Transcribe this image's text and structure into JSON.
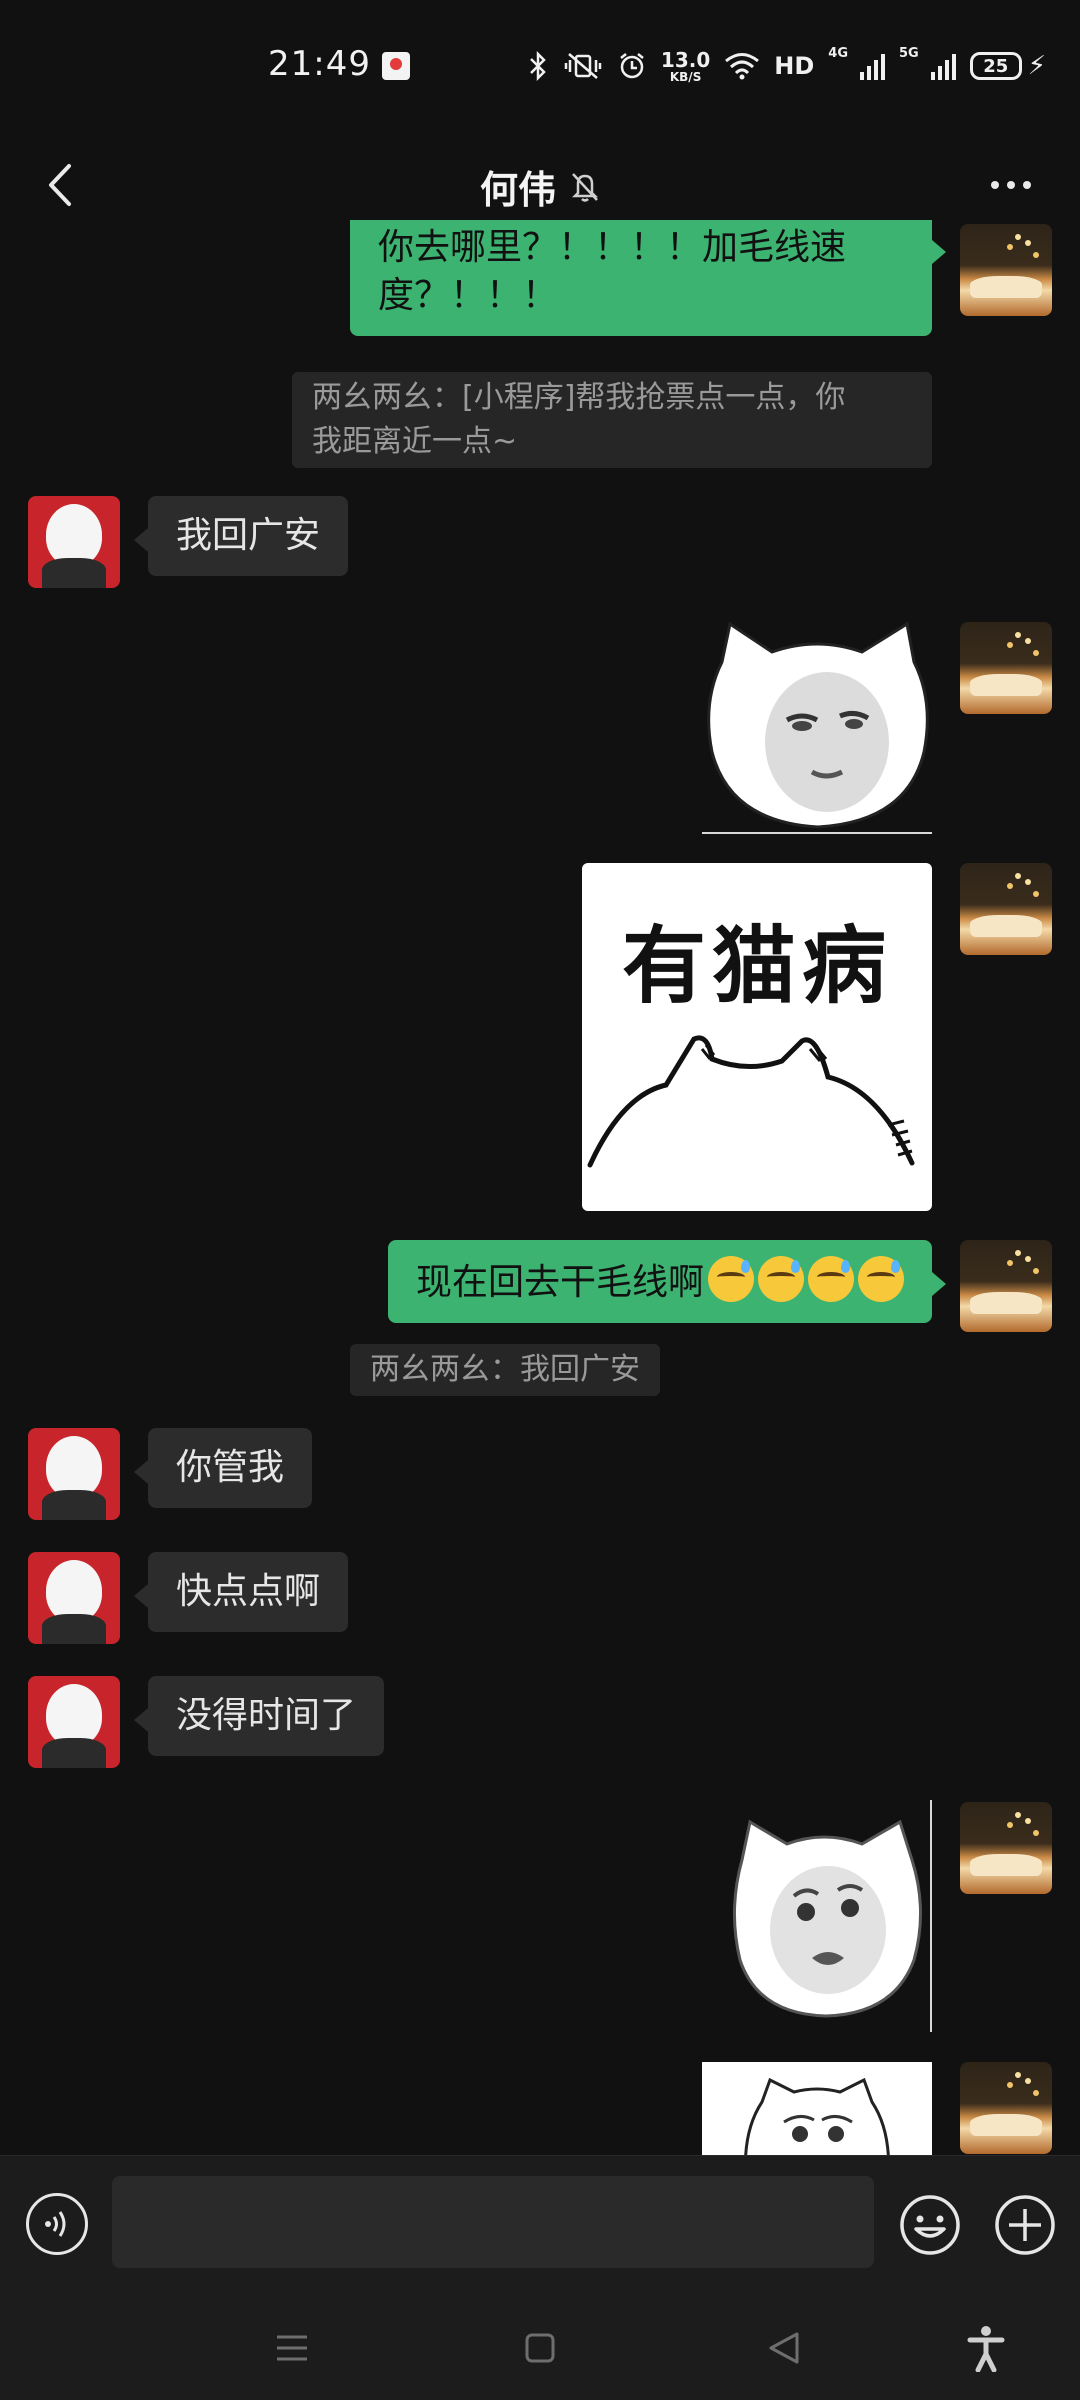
{
  "status_bar": {
    "time": "21:49",
    "net_speed_value": "13.0",
    "net_speed_unit": "KB/S",
    "hd_label": "HD",
    "sim1_label": "4G",
    "sim2_label": "5G",
    "battery_level": "25"
  },
  "header": {
    "title": "何伟"
  },
  "messages": [
    {
      "type": "text",
      "from": "me",
      "text_line1": "你去哪里？！！！！加毛线速",
      "text_line2": "度？！！！"
    },
    {
      "type": "quote",
      "text_line1": "两幺两幺：[小程序]帮我抢票点一点，你",
      "text_line2": "我距离近一点~"
    },
    {
      "type": "text",
      "from": "them",
      "text": "我回广安"
    },
    {
      "type": "sticker",
      "from": "me",
      "sticker": "cat-face-sticker"
    },
    {
      "type": "sticker",
      "from": "me",
      "sticker": "cat-text-sticker",
      "caption": "有猫病"
    },
    {
      "type": "text",
      "from": "me",
      "text": "现在回去干毛线啊",
      "emoji_count": 4
    },
    {
      "type": "quote",
      "text": "两幺两幺：我回广安"
    },
    {
      "type": "text",
      "from": "them",
      "text": "你管我"
    },
    {
      "type": "text",
      "from": "them",
      "text": "快点点啊"
    },
    {
      "type": "text",
      "from": "them",
      "text": "没得时间了"
    },
    {
      "type": "sticker",
      "from": "me",
      "sticker": "cat-face-sticker"
    },
    {
      "type": "sticker",
      "from": "me",
      "sticker": "cat-face-sticker"
    }
  ],
  "input": {
    "value": "",
    "placeholder": ""
  },
  "colors": {
    "background": "#111111",
    "my_bubble": "#3cb371",
    "their_bubble": "#2c2c2c",
    "quote_bg": "#262626"
  },
  "icons": [
    "back-arrow-icon",
    "mute-bell-icon",
    "more-dots-icon",
    "voice-icon",
    "emoji-icon",
    "plus-icon",
    "menu-icon",
    "home-square-icon",
    "back-triangle-icon",
    "accessibility-icon"
  ]
}
